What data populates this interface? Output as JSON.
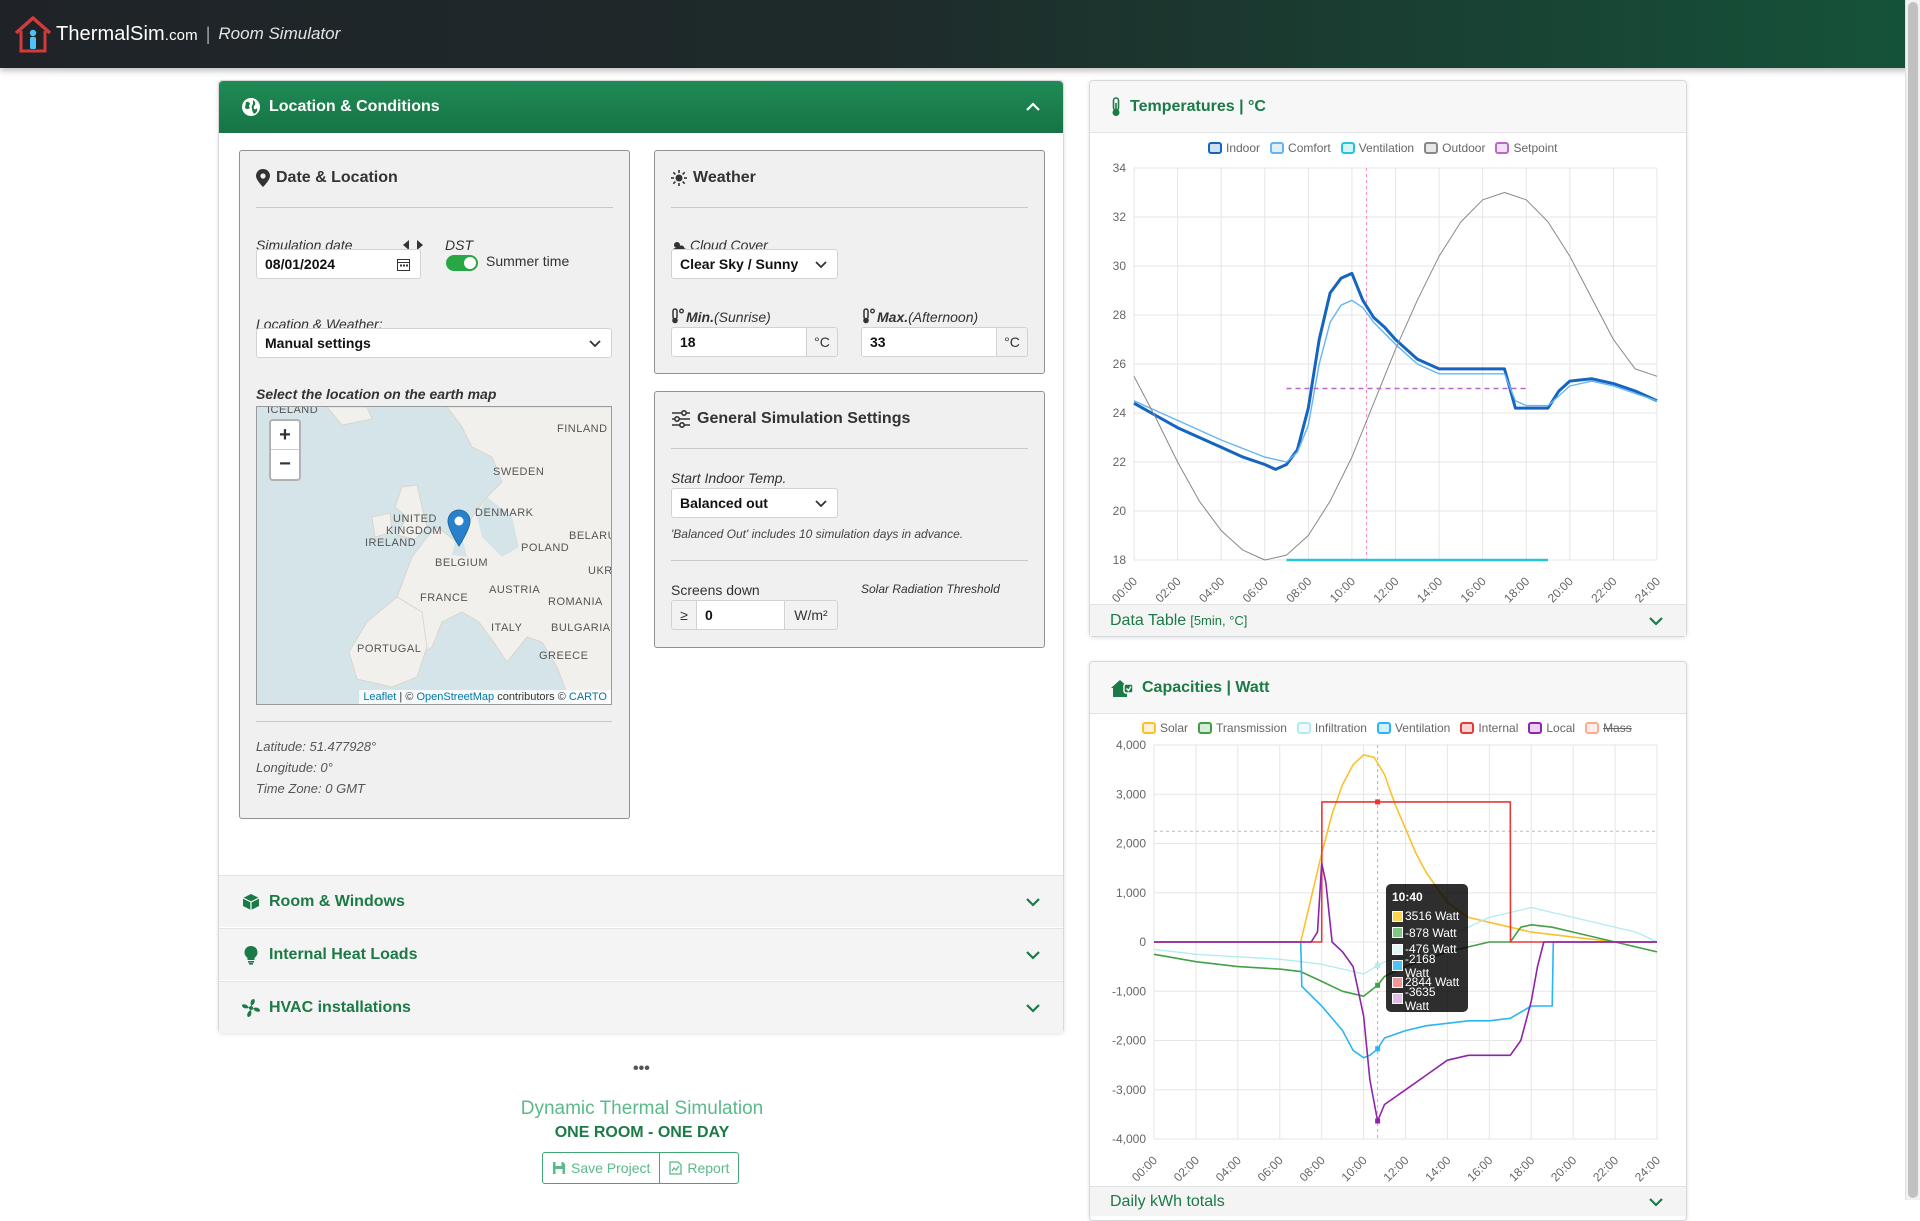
{
  "header": {
    "brand": "ThermalSim",
    "brand_tld": ".com",
    "separator": "|",
    "subtitle": "Room Simulator"
  },
  "location_panel": {
    "title": "Location & Conditions",
    "date_location": {
      "title": "Date & Location",
      "sim_date_label": "Simulation date",
      "sim_date_value": "08/01/2024",
      "dst_label": "DST",
      "dst_toggle_label": "Summer time",
      "dst_on": true,
      "location_label": "Location & Weather:",
      "location_value": "Manual settings",
      "map_label": "Select the location on the earth map",
      "map_labels": [
        "ICELAND",
        "FINLAND",
        "SWEDEN",
        "UNITED",
        "KINGDOM",
        "DENMARK",
        "IRELAND",
        "BELARU",
        "BELGIUM",
        "POLAND",
        "UKR",
        "FRANCE",
        "AUSTRIA",
        "ROMANIA",
        "ITALY",
        "BULGARIA",
        "PORTUGAL",
        "GREECE"
      ],
      "map_attr_leaflet": "Leaflet",
      "map_attr_sep": " | © ",
      "map_attr_osm": "OpenStreetMap",
      "map_attr_mid": " contributors © ",
      "map_attr_carto": "CARTO",
      "zoom_in": "+",
      "zoom_out": "−",
      "latitude": "Latitude: 51.477928°",
      "longitude": "Longitude: 0°",
      "timezone": "Time Zone: 0 GMT"
    },
    "weather": {
      "title": "Weather",
      "cloud_label": "Cloud Cover",
      "cloud_value": "Clear Sky / Sunny",
      "min_label_bold": "Min.",
      "min_label_note": "(Sunrise)",
      "min_value": "18",
      "max_label_bold": "Max.",
      "max_label_note": "(Afternoon)",
      "max_value": "33",
      "unit_c": "°C"
    },
    "general": {
      "title": "General Simulation Settings",
      "start_label": "Start Indoor Temp.",
      "start_value": "Balanced out",
      "start_note": "'Balanced Out' includes 10 simulation days in advance.",
      "screens_label": "Screens down",
      "threshold_label": "Solar Radiation Threshold",
      "screens_prefix": "≥",
      "screens_value": "0",
      "screens_unit": "W/m²"
    }
  },
  "collapsed_panels": [
    {
      "title": "Room & Windows",
      "icon": "box-icon"
    },
    {
      "title": "Internal Heat Loads",
      "icon": "lightbulb-icon"
    },
    {
      "title": "HVAC installations",
      "icon": "fan-icon"
    }
  ],
  "footer": {
    "dots": "•••",
    "title": "Dynamic Thermal Simulation",
    "subtitle": "ONE ROOM - ONE DAY",
    "save_label": "Save Project",
    "report_label": "Report"
  },
  "temp_panel": {
    "title": "Temperatures | °C",
    "data_table_label": "Data Table",
    "data_table_unit": "[5min, °C]"
  },
  "cap_panel": {
    "title": "Capacities | Watt",
    "bottom_bar_label": "Daily kWh totals",
    "tooltip": {
      "time": "10:40",
      "rows": [
        {
          "value": "3516 Watt",
          "color": "#ffd54f"
        },
        {
          "value": "-878 Watt",
          "color": "#81c784"
        },
        {
          "value": "-476 Watt",
          "color": "#e0f7fa"
        },
        {
          "value": "-2168 Watt",
          "color": "#4fc3f7"
        },
        {
          "value": "2844 Watt",
          "color": "#ef9a9a"
        },
        {
          "value": "-3635 Watt",
          "color": "#e1bee7"
        }
      ]
    }
  },
  "chart_data": [
    {
      "type": "line",
      "title": "Temperatures | °C",
      "x_ticks": [
        "00:00",
        "02:00",
        "04:00",
        "06:00",
        "08:00",
        "10:00",
        "12:00",
        "14:00",
        "16:00",
        "18:00",
        "20:00",
        "22:00",
        "24:00"
      ],
      "y_ticks": [
        "18",
        "20",
        "22",
        "24",
        "26",
        "28",
        "30",
        "32",
        "34"
      ],
      "ylim": [
        18,
        34
      ],
      "grid": true,
      "legend_position": "top",
      "series": [
        {
          "name": "Indoor",
          "color": "#1565c0",
          "x": [
            0,
            1,
            2,
            3,
            4,
            5,
            6,
            6.5,
            7,
            7.5,
            8,
            8.5,
            9,
            9.5,
            10,
            10.5,
            11,
            11.5,
            12,
            13,
            14,
            15,
            16,
            16.5,
            17,
            17.5,
            18,
            18.5,
            19,
            19.5,
            20,
            21,
            22,
            23,
            24
          ],
          "y": [
            24.4,
            23.9,
            23.4,
            23.0,
            22.6,
            22.2,
            21.9,
            21.7,
            21.9,
            22.5,
            24.2,
            27.0,
            28.9,
            29.5,
            29.7,
            28.6,
            27.9,
            27.5,
            27.0,
            26.2,
            25.8,
            25.8,
            25.8,
            25.8,
            25.8,
            24.2,
            24.2,
            24.2,
            24.2,
            24.9,
            25.3,
            25.4,
            25.2,
            24.9,
            24.5
          ]
        },
        {
          "name": "Comfort",
          "color": "#64b5f6",
          "x": [
            0,
            2,
            4,
            6,
            7,
            7.5,
            8,
            8.5,
            9,
            9.5,
            10,
            10.5,
            11,
            12,
            13,
            14,
            15,
            16,
            17,
            17.5,
            18,
            19,
            20,
            21,
            22,
            24
          ],
          "y": [
            24.5,
            23.7,
            22.9,
            22.2,
            22.0,
            22.4,
            23.5,
            26.0,
            27.7,
            28.4,
            28.6,
            28.3,
            27.7,
            26.8,
            26.0,
            25.6,
            25.6,
            25.6,
            25.6,
            24.5,
            24.3,
            24.3,
            25.1,
            25.3,
            25.1,
            24.5
          ]
        },
        {
          "name": "Ventilation",
          "color": "#26c6da",
          "x": [
            7,
            19
          ],
          "y": [
            18,
            18
          ]
        },
        {
          "name": "Outdoor",
          "color": "#888888",
          "x": [
            0,
            1,
            2,
            3,
            4,
            5,
            6,
            7,
            8,
            9,
            10,
            11,
            12,
            13,
            14,
            15,
            16,
            17,
            18,
            19,
            20,
            21,
            22,
            23,
            24
          ],
          "y": [
            25.5,
            23.8,
            22.0,
            20.4,
            19.2,
            18.4,
            18.0,
            18.2,
            19.0,
            20.4,
            22.2,
            24.4,
            26.6,
            28.6,
            30.4,
            31.8,
            32.7,
            33.0,
            32.7,
            31.8,
            30.4,
            28.7,
            27.0,
            25.8,
            25.5
          ]
        },
        {
          "name": "Setpoint",
          "color": "#ba68c8",
          "x": [
            7,
            18
          ],
          "y": [
            25,
            25
          ]
        }
      ],
      "cursor_x": 10.67
    },
    {
      "type": "line",
      "title": "Capacities | Watt",
      "x_ticks": [
        "00:00",
        "02:00",
        "04:00",
        "06:00",
        "08:00",
        "10:00",
        "12:00",
        "14:00",
        "16:00",
        "18:00",
        "20:00",
        "22:00",
        "24:00"
      ],
      "y_ticks": [
        "4,000",
        "3,000",
        "2,000",
        "1,000",
        "0",
        "-1,000",
        "-2,000",
        "-3,000",
        "-4,000"
      ],
      "ylim": [
        -4000,
        4000
      ],
      "grid": true,
      "legend_position": "top",
      "series": [
        {
          "name": "Solar",
          "color": "#fbc02d",
          "x": [
            0,
            6,
            6.5,
            7,
            7.5,
            8,
            8.5,
            9,
            9.5,
            10,
            10.5,
            11,
            11.5,
            12,
            12.5,
            13,
            13.5,
            14,
            15,
            16,
            17,
            18,
            19,
            20,
            21,
            22,
            23,
            24
          ],
          "y": [
            0,
            0,
            0,
            0,
            900,
            1800,
            2600,
            3200,
            3600,
            3800,
            3750,
            3400,
            2800,
            2300,
            1800,
            1400,
            1100,
            800,
            500,
            400,
            300,
            200,
            150,
            100,
            50,
            0,
            0,
            0
          ]
        },
        {
          "name": "Transmission",
          "color": "#43a047",
          "x": [
            0,
            2,
            4,
            6,
            7,
            8,
            9,
            10,
            10.67,
            11,
            12,
            13,
            14,
            15,
            16,
            17,
            17.5,
            18,
            19,
            20,
            22,
            24
          ],
          "y": [
            -250,
            -400,
            -500,
            -550,
            -600,
            -800,
            -1000,
            -1100,
            -878,
            -700,
            -500,
            -350,
            -200,
            -100,
            0,
            0,
            300,
            350,
            300,
            200,
            0,
            -200
          ]
        },
        {
          "name": "Infiltration",
          "color": "#b2ebf2",
          "x": [
            0,
            2,
            4,
            6,
            7,
            8,
            9,
            10,
            10.67,
            11,
            12,
            13,
            14,
            15,
            16,
            17,
            18,
            19,
            20,
            21,
            22,
            23,
            24
          ],
          "y": [
            -150,
            -250,
            -300,
            -350,
            -400,
            -450,
            -550,
            -650,
            -476,
            -400,
            -300,
            -100,
            100,
            300,
            500,
            600,
            700,
            600,
            500,
            400,
            300,
            200,
            0
          ]
        },
        {
          "name": "Ventilation",
          "color": "#29b6f6",
          "x": [
            0,
            7,
            7.05,
            8,
            9,
            9.5,
            10,
            10.3,
            10.67,
            11,
            12,
            13,
            14,
            15,
            16,
            17,
            18,
            18.5,
            19,
            19.05,
            24
          ],
          "y": [
            0,
            0,
            -900,
            -1300,
            -1800,
            -2200,
            -2350,
            -2300,
            -2168,
            -1950,
            -1800,
            -1700,
            -1650,
            -1600,
            -1600,
            -1550,
            -1300,
            -1300,
            -1300,
            0,
            0
          ]
        },
        {
          "name": "Internal",
          "color": "#e53935",
          "x": [
            0,
            8,
            8.01,
            10.67,
            17,
            17.01,
            24
          ],
          "y": [
            0,
            0,
            2844,
            2844,
            2844,
            0,
            0
          ]
        },
        {
          "name": "Local",
          "color": "#8e24aa",
          "x": [
            0,
            7.5,
            7.8,
            8,
            8.2,
            8.5,
            9,
            9.5,
            10,
            10.3,
            10.67,
            11,
            12,
            13,
            14,
            15,
            16,
            17,
            17.5,
            18,
            18.3,
            18.6,
            19,
            24
          ],
          "y": [
            0,
            0,
            200,
            1600,
            1200,
            0,
            -200,
            -500,
            -1500,
            -2800,
            -3635,
            -3300,
            -3000,
            -2700,
            -2400,
            -2300,
            -2300,
            -2300,
            -2000,
            -1200,
            -500,
            0,
            0,
            0
          ]
        },
        {
          "name": "Mass",
          "color": "#ffab91",
          "x": [],
          "y": []
        }
      ],
      "cursor_x": 10.67
    }
  ]
}
